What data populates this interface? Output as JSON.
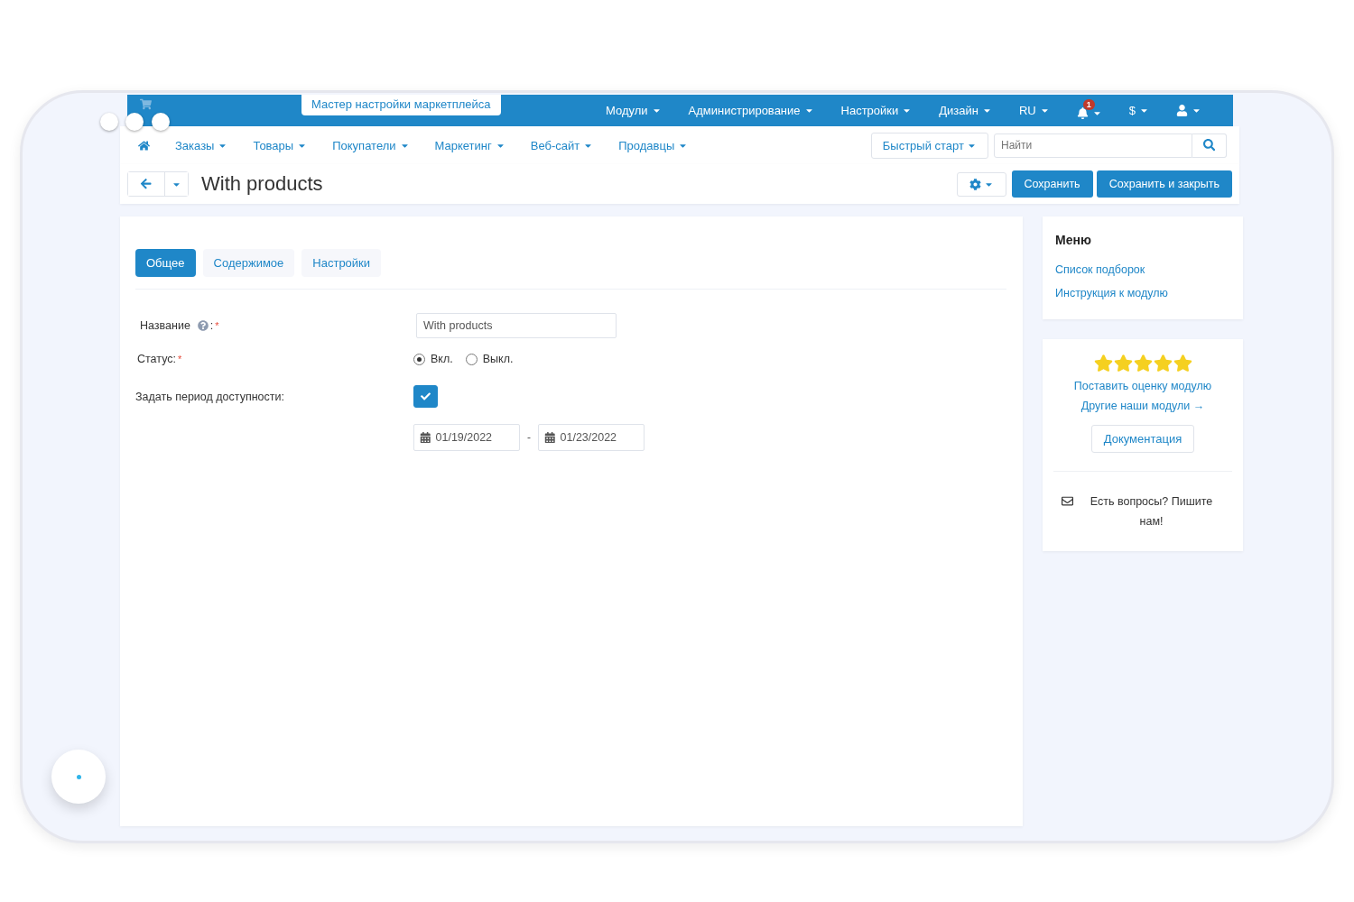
{
  "wizard_button": "Мастер настройки маркетплейса",
  "top_menu": [
    {
      "label": "Модули"
    },
    {
      "label": "Администрирование"
    },
    {
      "label": "Настройки"
    },
    {
      "label": "Дизайн"
    },
    {
      "label": "RU"
    }
  ],
  "notifications": {
    "count": "1"
  },
  "currency": {
    "label": "$"
  },
  "nav": {
    "items": [
      {
        "label": "Заказы"
      },
      {
        "label": "Товары"
      },
      {
        "label": "Покупатели"
      },
      {
        "label": "Маркетинг"
      },
      {
        "label": "Веб-сайт"
      },
      {
        "label": "Продавцы"
      }
    ],
    "quick_start": "Быстрый старт",
    "search": {
      "placeholder": "Найти"
    }
  },
  "page_title": "With products",
  "actions": [
    "Сохранить",
    "Сохранить и закрыть"
  ],
  "tabs": [
    {
      "label": "Общее",
      "selected": true
    },
    {
      "label": "Содержимое",
      "selected": false
    },
    {
      "label": "Настройки",
      "selected": false
    }
  ],
  "form": {
    "name": {
      "label": "Название",
      "suffix": ":",
      "required_mark": "*",
      "value": "With products"
    },
    "status": {
      "label": "Статус:",
      "required_mark": "*",
      "options": [
        {
          "label": "Вкл.",
          "selected": true
        },
        {
          "label": "Выкл.",
          "selected": false
        }
      ]
    },
    "availability": {
      "label": "Задать период доступности:",
      "checked": true,
      "date_from": "01/19/2022",
      "separator": "-",
      "date_to": "01/23/2022"
    }
  },
  "sidebar": {
    "menu": {
      "title": "Меню",
      "links": [
        "Список подборок",
        "Инструкция к модулю"
      ]
    },
    "rating": {
      "stars": 5,
      "rate_link": "Поставить оценку модулю",
      "modules_link": "Другие наши модули →",
      "docs_button": "Документация",
      "contact": "Есть вопросы? Пишите нам!"
    }
  }
}
